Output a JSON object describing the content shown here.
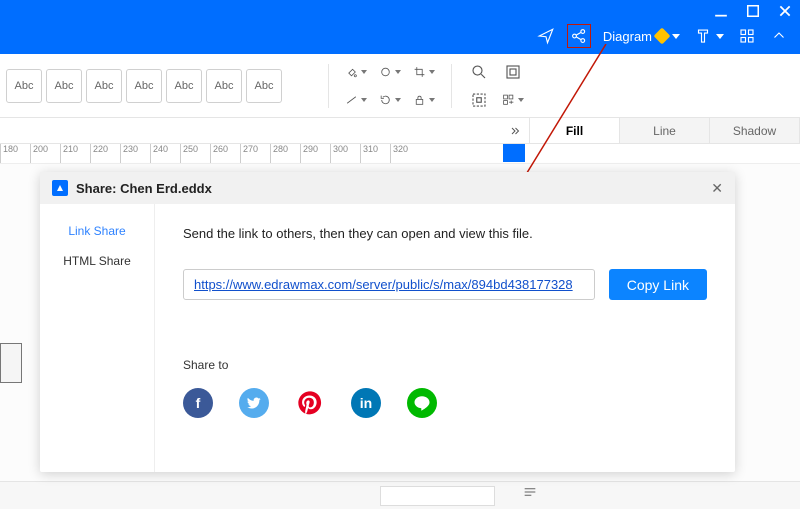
{
  "window": {
    "diagram_label": "Diagram"
  },
  "ribbon": {
    "abc_label": "Abc"
  },
  "tabs": {
    "fill": "Fill",
    "line": "Line",
    "shadow": "Shadow"
  },
  "ruler": {
    "marks": [
      "180",
      "200",
      "210",
      "220",
      "230",
      "240",
      "250",
      "260",
      "270",
      "280",
      "290",
      "300",
      "310",
      "320"
    ]
  },
  "dialog": {
    "title": "Share: Chen Erd.eddx",
    "side": {
      "link_share": "Link Share",
      "html_share": "HTML Share"
    },
    "desc": "Send the link to others, then they can open and view this file.",
    "url": "https://www.edrawmax.com/server/public/s/max/894bd438177328",
    "copy_btn": "Copy Link",
    "share_to": "Share to",
    "social": {
      "fb": "f",
      "tw": "t",
      "pin": "P",
      "li": "in",
      "line": "LINE"
    }
  }
}
